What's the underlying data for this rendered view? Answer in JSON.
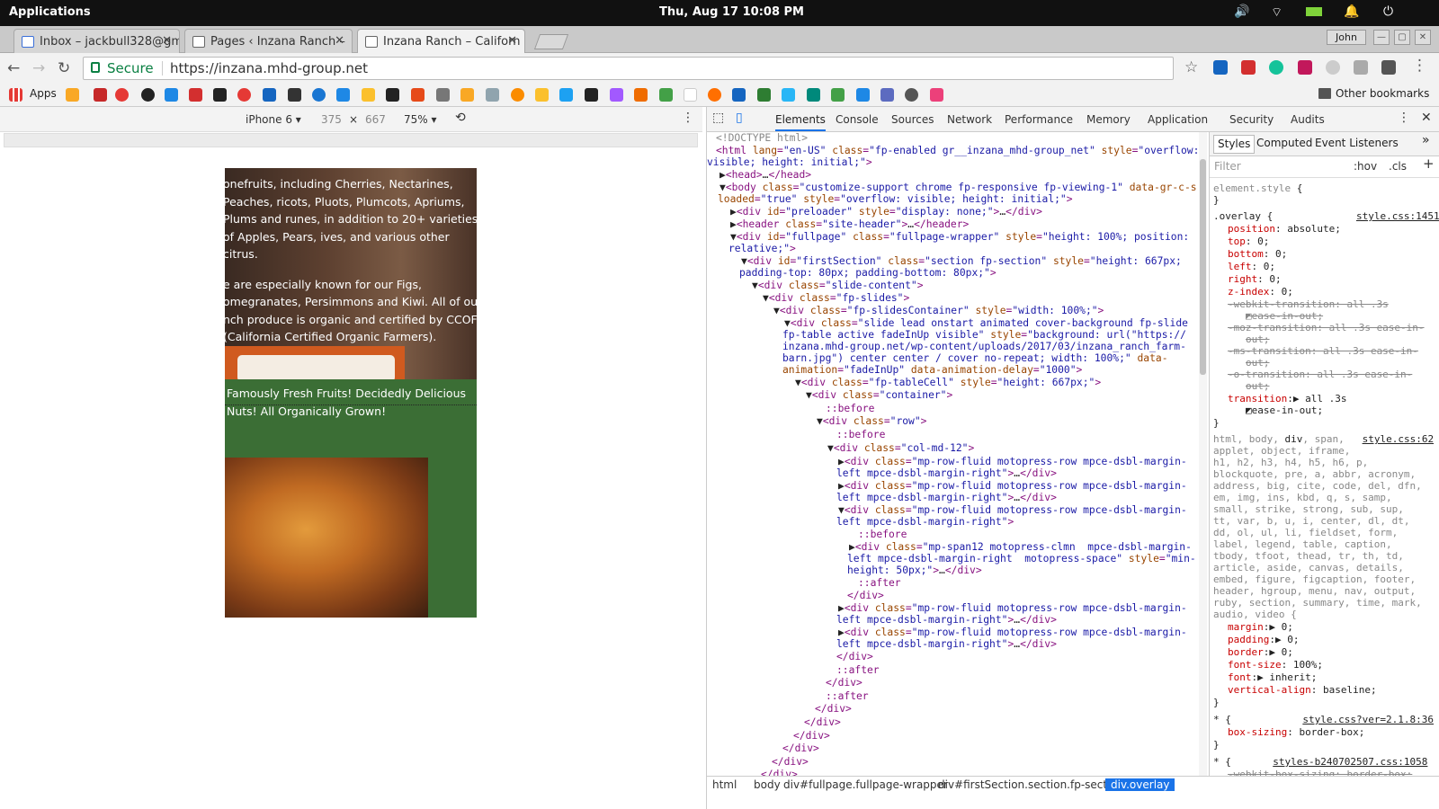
{
  "system_bar": {
    "apps_label": "Applications",
    "clock": "Thu, Aug 17   10:08 PM"
  },
  "tabs": [
    {
      "title": "Inbox – jackbull328@gm",
      "close": "✕"
    },
    {
      "title": "Pages ‹ Inzana Ranch –",
      "close": "✕"
    },
    {
      "title": "Inzana Ranch – Californ",
      "close": "✕"
    }
  ],
  "user_name": "John",
  "omnibox": {
    "secure_label": "Secure",
    "url": "https://inzana.mhd-group.net"
  },
  "bookmarks": {
    "apps_label": "Apps",
    "other_label": "Other bookmarks"
  },
  "device_toolbar": {
    "device": "iPhone 6 ▾",
    "width": "375",
    "times": "×",
    "height": "667",
    "zoom": "75% ▾"
  },
  "viewport": {
    "para1": "onefruits, including Cherries, Nectarines, Peaches, ricots, Pluots, Plumcots, Apriums, Plums and runes, in addition to 20+ varieties of Apples, Pears, ives, and various other citrus.",
    "para2": "e are especially known for our Figs, omegranates, Persimmons and Kiwi. All of our nch produce is organic and certified by CCOF (California Certified Organic Farmers).",
    "slogan": "Famously Fresh Fruits!    Decidedly Delicious Nuts!    All Organically Grown!"
  },
  "devtools_tabs": [
    "Elements",
    "Console",
    "Sources",
    "Network",
    "Performance",
    "Memory",
    "Application",
    "Security",
    "Audits"
  ],
  "styles_tabs": [
    "Styles",
    "Computed",
    "Event Listeners"
  ],
  "filter": {
    "placeholder": "Filter",
    "hov": ":hov",
    "cls": ".cls",
    "plus": "+"
  },
  "breadcrumbs": [
    "html",
    "body",
    "div#fullpage.fullpage-wrapper",
    "div#firstSection.section.fp-section",
    "div.overlay"
  ],
  "accent_color": "#1a73e8"
}
